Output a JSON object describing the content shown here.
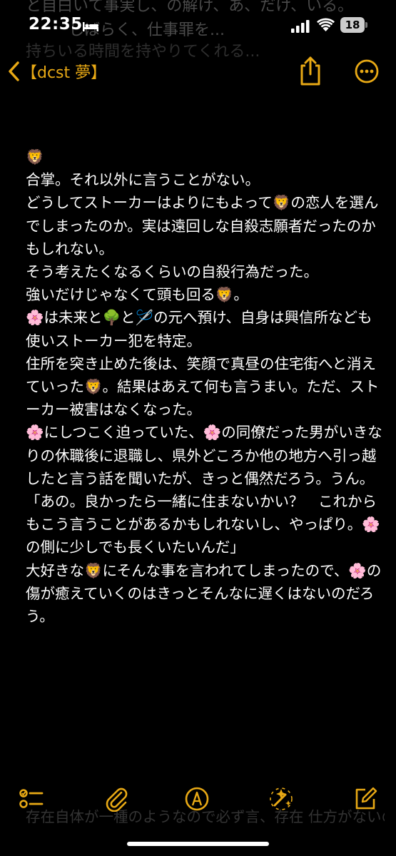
{
  "background_text": {
    "line1": "と自白いて事実し、の解け、あ、だけ、いる。",
    "line2": "しばらく、仕事罪を...",
    "line3": "持ちいる時間を持やりてくれる..."
  },
  "status_bar": {
    "time": "22:35",
    "battery_level": "18",
    "icons": [
      "bed-icon",
      "signal-icon",
      "wifi-icon",
      "battery-icon"
    ]
  },
  "nav": {
    "back_label": "【dcst 夢】",
    "accent_color": "#e8a915",
    "icons": [
      "chevron-left-icon",
      "share-icon",
      "more-icon"
    ]
  },
  "note": {
    "text": "🦁\n合掌。それ以外に言うことがない。\nどうしてストーカーはよりにもよって🦁の恋人を選んでしまったのか。実は遠回しな自殺志願者だったのかもしれない。\nそう考えたくなるくらいの自殺行為だった。\n強いだけじゃなくて頭も回る🦁。\n🌸は未来と🌳と🪡の元へ預け、自身は興信所なども使いストーカー犯を特定。\n住所を突き止めた後は、笑顔で真昼の住宅街へと消えていった🦁。結果はあえて何も言うまい。ただ、ストーカー被害はなくなった。\n🌸にしつこく迫っていた、🌸の同僚だった男がいきなりの休職後に退職し、県外どころか他の地方へ引っ越したと言う話を聞いたが、きっと偶然だろう。うん。\n「あの。良かったら一緒に住まないかい？　これからもこう言うことがあるかもしれないし、やっぱり。🌸の側に少しでも長くいたいんだ」\n大好きな🦁にそんな事を言われてしまったので、🌸の傷が癒えていくのはきっとそんなに遅くはないのだろう。"
  },
  "bottom_ghost_text": "存在自体が一種のようなので必ず言、存在\n仕方がないのア...",
  "toolbar": {
    "icons": [
      "checklist-icon",
      "paperclip-icon",
      "markup-pen-icon",
      "sparkles-icon",
      "compose-icon"
    ]
  }
}
